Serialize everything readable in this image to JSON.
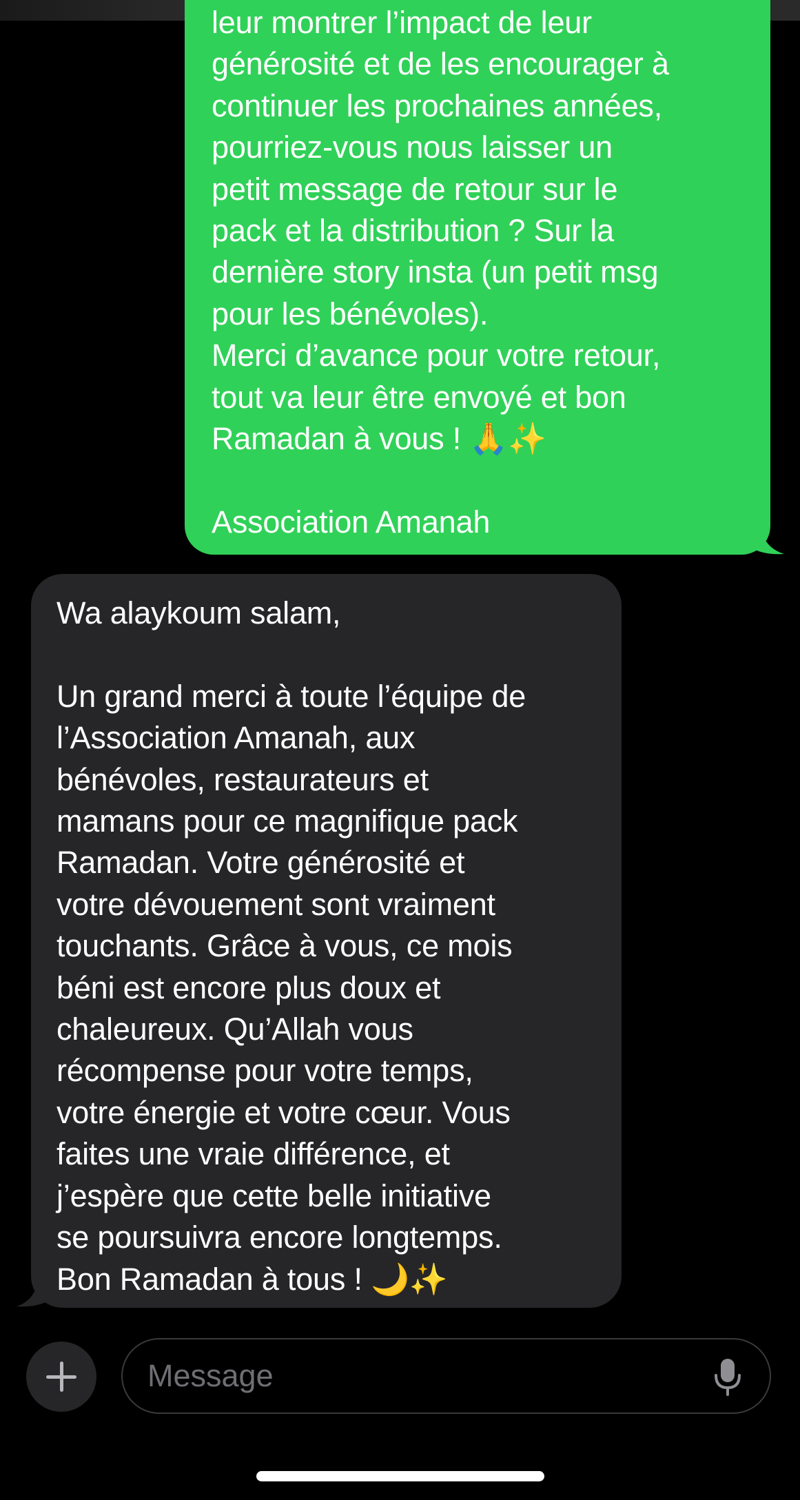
{
  "conversation": {
    "outgoing_message": {
      "text": "leur montrer l’impact de leur\ngénérosité et de les encourager à\ncontinuer les prochaines années,\npourriez-vous nous laisser un\npetit message de retour sur le\npack et la distribution ? Sur la\ndernière story insta (un petit msg\npour les bénévoles).\nMerci d’avance pour votre retour,\ntout va leur être envoyé et bon\nRamadan à vous ! 🙏✨\n\nAssociation Amanah",
      "color": "#30d158"
    },
    "incoming_message": {
      "text": "Wa alaykoum salam,\n\nUn grand merci à toute l’équipe de\nl’Association Amanah, aux\nbénévoles, restaurateurs et\nmamans pour ce magnifique pack\nRamadan. Votre générosité et\nvotre dévouement sont vraiment\ntouchants. Grâce à vous, ce mois\nbéni est encore plus doux et\nchaleureux. Qu’Allah vous\nrécompense pour votre temps,\nvotre énergie et votre cœur. Vous\nfaites une vraie différence, et\nj’espère que cette belle initiative\nse poursuivra encore longtemps.\nBon Ramadan à tous ! 🌙✨",
      "color": "#262628"
    }
  },
  "composer": {
    "placeholder": "Message",
    "value": "",
    "add_icon": "plus-icon",
    "mic_icon": "microphone-icon"
  },
  "theme": {
    "background": "#000000",
    "text": "#ffffff",
    "placeholder": "#6e6e73"
  }
}
